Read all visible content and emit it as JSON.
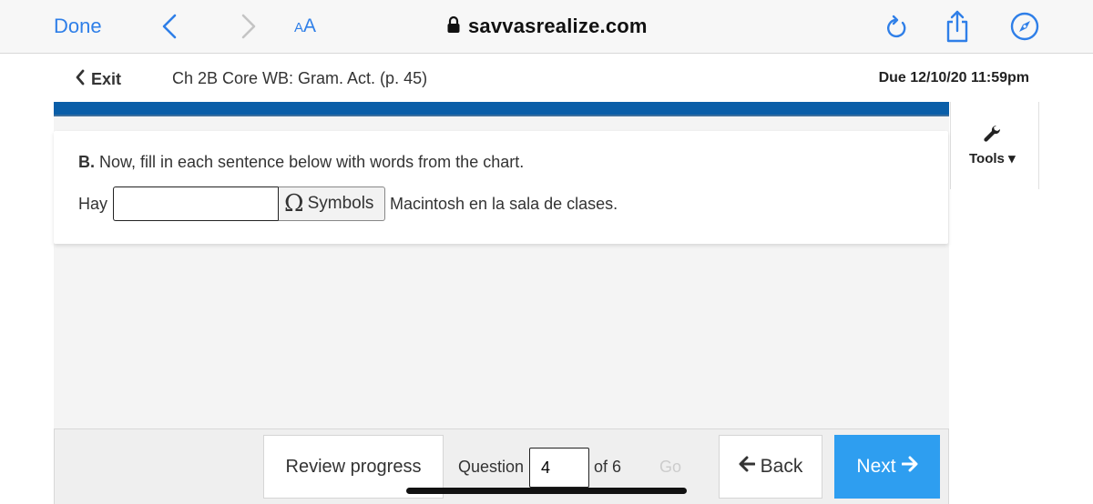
{
  "browser": {
    "done_label": "Done",
    "text_size_small": "A",
    "text_size_large": "A",
    "url": "savvasrealize.com",
    "icons": [
      "back-chevron-icon",
      "forward-chevron-icon",
      "lock-icon",
      "reload-icon",
      "share-icon",
      "compass-icon"
    ],
    "accent_color": "#2f7fe8"
  },
  "header": {
    "exit_label": "Exit",
    "assignment_title": "Ch 2B Core WB: Gram. Act. (p. 45)",
    "due_label": "Due 12/10/20 11:59pm",
    "stripe_color": "#0a5ea8"
  },
  "tools": {
    "label": "Tools"
  },
  "question": {
    "instruction_prefix": "B.",
    "instruction_text": " Now, fill in each sentence below with words from the chart.",
    "sentence_before": "Hay",
    "answer_value": "",
    "symbols_glyph": "Ω",
    "symbols_label": "Symbols",
    "sentence_after": "Macintosh en la sala de clases."
  },
  "footer": {
    "review_label": "Review progress",
    "question_label": "Question",
    "question_number": "4",
    "of_label": "of 6",
    "go_label": "Go",
    "back_label": "Back",
    "next_label": "Next",
    "next_color": "#2e9ef0"
  }
}
